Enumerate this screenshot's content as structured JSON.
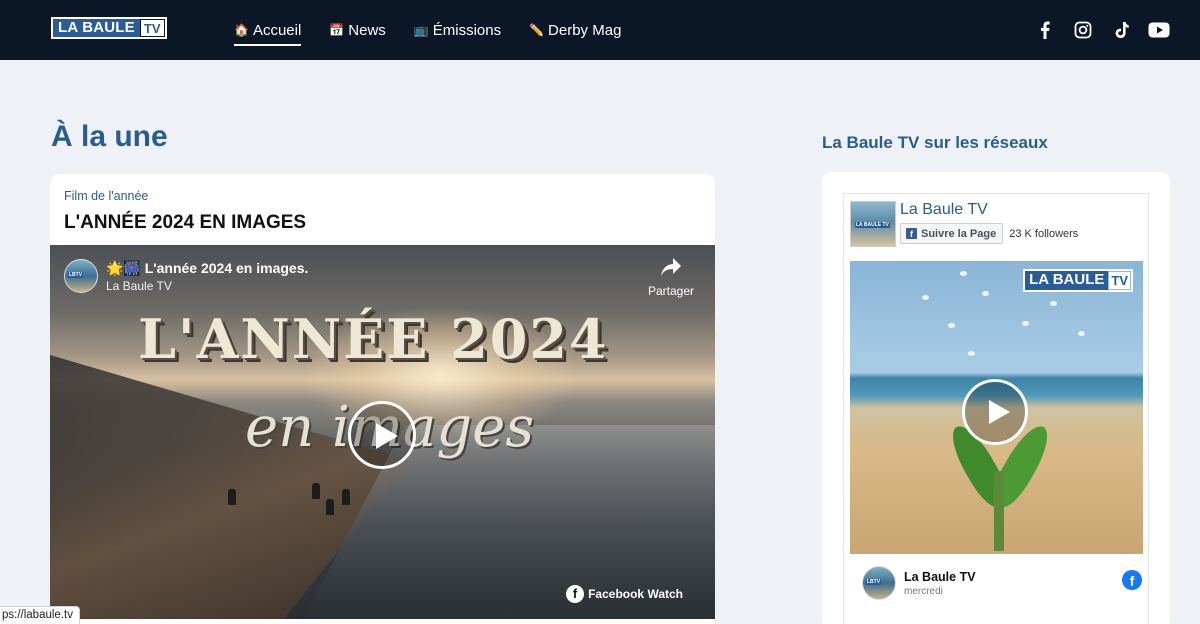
{
  "header": {
    "logo": {
      "la": "LA BAULE",
      "tv": "TV"
    },
    "nav": [
      {
        "emoji": "🏠",
        "label": "Accueil",
        "active": true
      },
      {
        "emoji": "📅",
        "label": "News",
        "active": false
      },
      {
        "emoji": "📺",
        "label": "Émissions",
        "active": false
      },
      {
        "emoji": "✏️",
        "label": "Derby Mag",
        "active": false
      }
    ],
    "socials": [
      "facebook-icon",
      "instagram-icon",
      "tiktok-icon",
      "youtube-icon"
    ]
  },
  "main": {
    "title": "À la une",
    "featured": {
      "kicker": "Film de l'année",
      "title": "L'ANNÉE 2024 EN IMAGES",
      "video": {
        "title": "🌟🎆 L'année 2024 en images.",
        "channel": "La Baule TV",
        "share_label": "Partager",
        "overlay_line1": "L'ANNÉE 2024",
        "overlay_line2": "en images",
        "watch_label": "Facebook Watch"
      }
    }
  },
  "sidebar": {
    "title": "La Baule TV sur les réseaux",
    "fb_page": {
      "name": "La Baule TV",
      "follow_label": "Suivre la Page",
      "followers": "23 K followers",
      "thumb_logo": "LA BAULE TV"
    },
    "post": {
      "logo": {
        "la": "LA BAULE",
        "tv": "TV"
      },
      "author": "La Baule TV",
      "time": "mercredi"
    }
  },
  "statusbar": {
    "url": "ps://labaule.tv"
  },
  "colors": {
    "header_bg": "#0b1627",
    "accent": "#2a5d8f",
    "page_bg": "#eef1f5",
    "facebook": "#1877f2"
  }
}
